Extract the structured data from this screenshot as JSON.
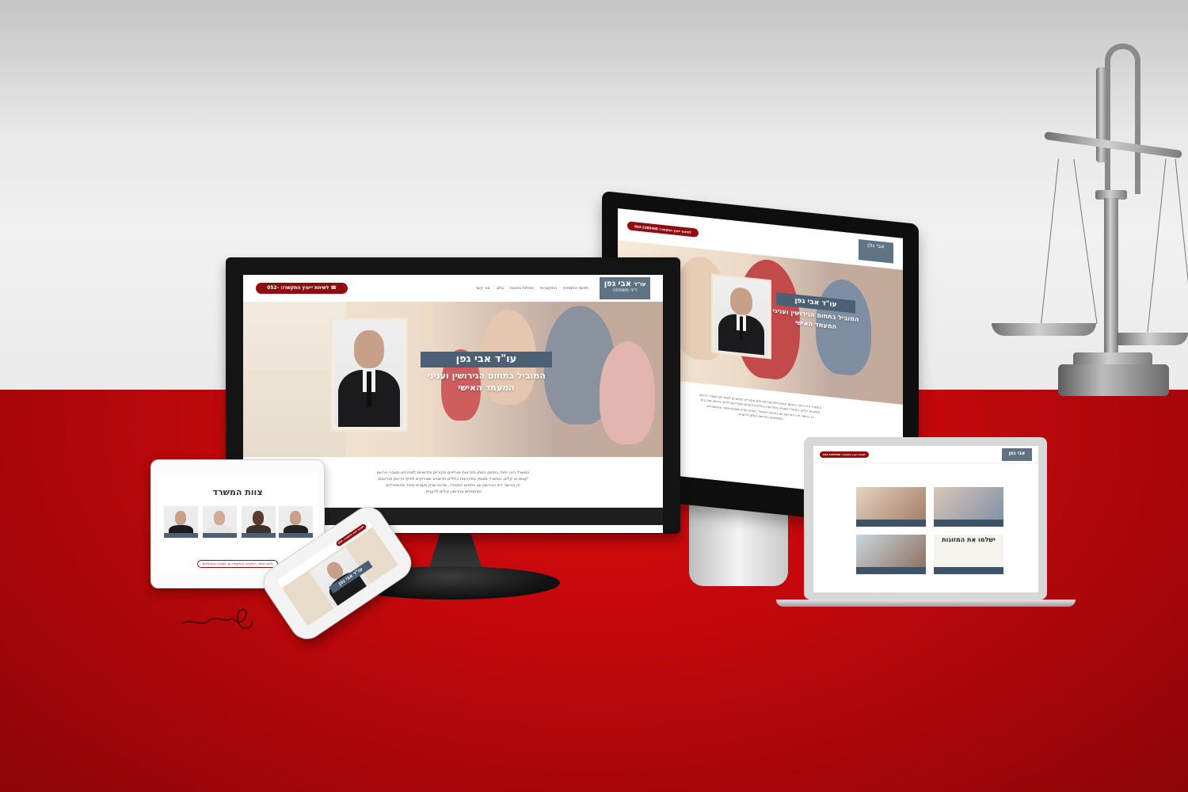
{
  "site": {
    "logo_prefix": "עו\"ד",
    "logo_name": "אבי גפן",
    "logo_sub": "דיני משפחה",
    "phone_cta": "לשיחת ייעוץ התקשרו: 052-5285400",
    "nav": [
      "צור קשר",
      "בלוג",
      "שאלות נפוצות",
      "התקשרות",
      "תחומי התמחות"
    ],
    "hero_name": "עו\"ד אבי גפן",
    "hero_line1": "המוביל בתחום הגירושין ועניני",
    "hero_line2": "המעמד האישי",
    "intro_lines": [
      "המשרד הינו ייחודי בתחום הנותן פתרונות יצירתיים מקוריים וחדשניים למתרחש משברי גירושין",
      "קשים או קלים. המשרד מצטיין בפתרונות כוללים חדשניים ומבריקים לתיקי גירושין מורכבים",
      "הן בכישור דיני הגירושין ועו בתחום הפסחרי, שירות שרק מעטים מאוד מהמשרדים",
      "המתמחים בגירושין יכולים להעניק."
    ]
  },
  "tablet": {
    "title": "צוות המשרד",
    "cta": "לחצו אחש , דסקרטי והתקשרו עד לסיום ההתהליכים"
  },
  "laptop": {
    "big_heading": "ישלמו את המזונות"
  },
  "colors": {
    "brand_red": "#8e0d10",
    "banner_blue": "#4b6075",
    "table_red": "#c00a0d"
  }
}
